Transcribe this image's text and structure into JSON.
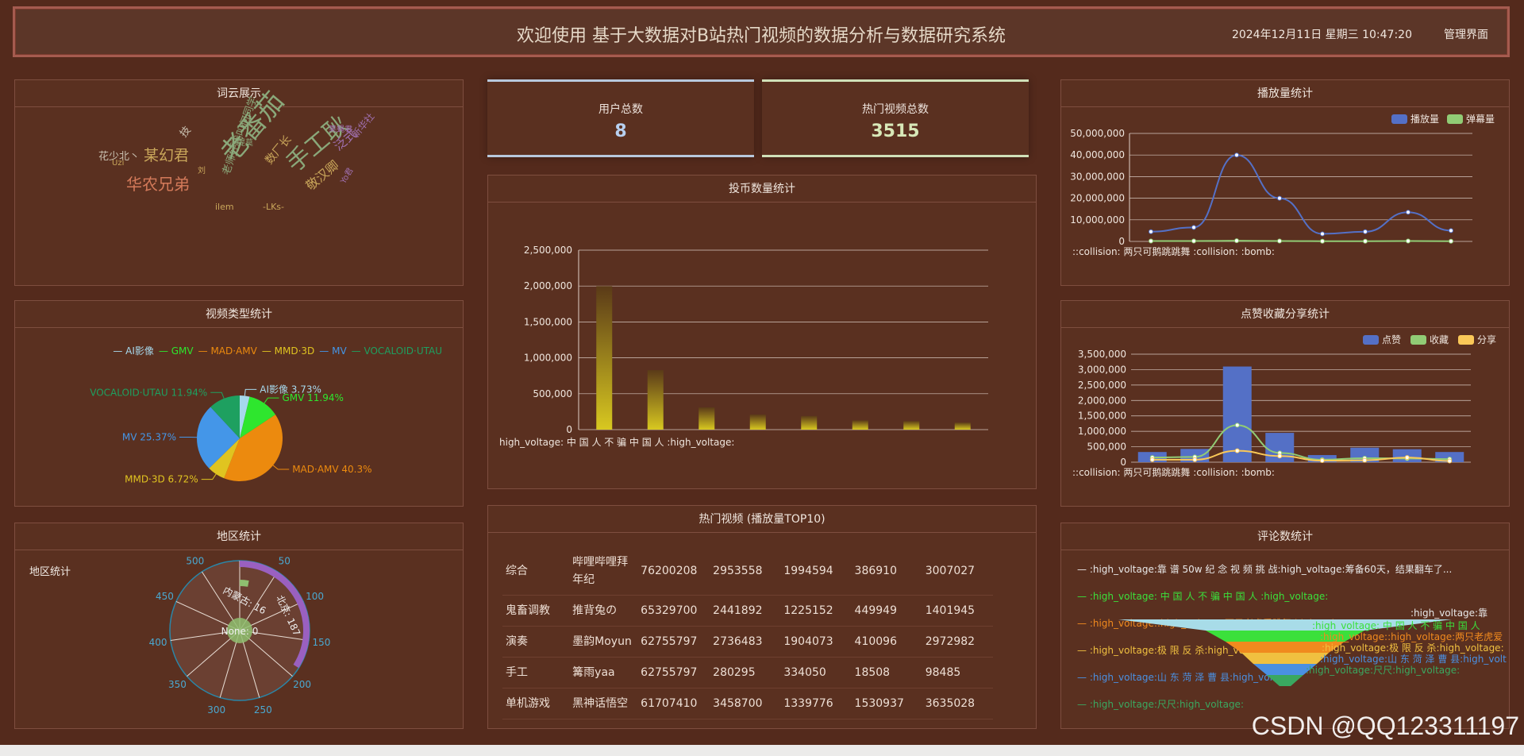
{
  "header": {
    "title": "欢迎使用 基于大数据对B站热门视频的数据分析与数据研究系统",
    "datetime": "2024年12月11日 星期三 10:47:20",
    "admin_link": "管理界面"
  },
  "panels": {
    "wordcloud": "词云展示",
    "video_type": "视频类型统计",
    "region": "地区统计",
    "coin": "投币数量统计",
    "top10": "热门视频 (播放量TOP10)",
    "play": "播放量统计",
    "like": "点赞收藏分享统计",
    "comment": "评论数统计"
  },
  "stats": {
    "users_label": "用户总数",
    "users_value": "8",
    "videos_label": "热门视频总数",
    "videos_value": "3515"
  },
  "wordcloud": [
    {
      "text": "老番茄",
      "color": "#8aa87a"
    },
    {
      "text": "手工耿",
      "color": "#8aa87a"
    },
    {
      "text": "华农兄弟",
      "color": "#d47a5a"
    },
    {
      "text": "某幻君",
      "color": "#c9a65a"
    },
    {
      "text": "花少北丶",
      "color": "#c9c0b0"
    },
    {
      "text": "敬汉卿",
      "color": "#c9a65a"
    },
    {
      "text": "老师好我叫何同学",
      "color": "#8aa87a"
    },
    {
      "text": "泛式",
      "color": "#a070b0"
    },
    {
      "text": "新华社",
      "color": "#a070b0"
    },
    {
      "text": "果蝇君",
      "color": "#a070b0"
    },
    {
      "text": "Uzi",
      "color": "#c9a65a"
    },
    {
      "text": "ilem",
      "color": "#c9a65a"
    },
    {
      "text": "-LKs-",
      "color": "#c9a65a"
    },
    {
      "text": "Yo君",
      "color": "#a070b0"
    },
    {
      "text": "技",
      "color": "#c9c0b0"
    },
    {
      "text": "数厂长",
      "color": "#c9a65a"
    },
    {
      "text": "冯提莫",
      "color": "#8aa87a"
    },
    {
      "text": "刘",
      "color": "#c9a65a"
    }
  ],
  "pie": {
    "legend": [
      "AI影像",
      "GMV",
      "MAD·AMV",
      "MMD·3D",
      "MV",
      "VOCALOID·UTAU"
    ],
    "slices": [
      {
        "name": "AI影像",
        "percent": 3.73,
        "label": "AI影像 3.73%",
        "color": "#a6d8ec"
      },
      {
        "name": "GMV",
        "percent": 11.94,
        "label": "GMV 11.94%",
        "color": "#2ee62e"
      },
      {
        "name": "MAD·AMV",
        "percent": 40.3,
        "label": "MAD·AMV 40.3%",
        "color": "#ec8a0e"
      },
      {
        "name": "MMD·3D",
        "percent": 6.72,
        "label": "MMD·3D 6.72%",
        "color": "#e0c420"
      },
      {
        "name": "MV",
        "percent": 25.37,
        "label": "MV 25.37%",
        "color": "#4496e8"
      },
      {
        "name": "VOCALOID·UTAU",
        "percent": 11.94,
        "label": "VOCALOID·UTAU 11.94%",
        "color": "#1ea060"
      }
    ]
  },
  "region": {
    "label": "地区统计",
    "ticks": [
      "0",
      "50",
      "100",
      "150",
      "200",
      "250",
      "300",
      "350",
      "400",
      "450",
      "500"
    ],
    "arc_labels": [
      "内蒙古: 16",
      "北京: 187"
    ],
    "center_label": "None: 0"
  },
  "coin_chart": {
    "type": "bar",
    "yticks": [
      "0",
      "500,000",
      "1,000,000",
      "1,500,000",
      "2,000,000",
      "2,500,000"
    ],
    "ylim": [
      0,
      2500000
    ],
    "values": [
      2000000,
      830000,
      310000,
      210000,
      190000,
      130000,
      120000,
      100000
    ],
    "xlabel_first": "high_voltage: 中 国 人 不 骗 中 国 人 :high_voltage:"
  },
  "table": {
    "rows": [
      [
        "综合",
        "哔哩哔哩拜年纪",
        "76200208",
        "2953558",
        "1994594",
        "386910",
        "3007027"
      ],
      [
        "鬼畜调教",
        "推背兔の",
        "65329700",
        "2441892",
        "1225152",
        "449949",
        "1401945"
      ],
      [
        "演奏",
        "墨韵Moyun",
        "62755797",
        "2736483",
        "1904073",
        "410096",
        "2972982"
      ],
      [
        "手工",
        "篝雨yaa",
        "62755797",
        "280295",
        "334050",
        "18508",
        "98485"
      ],
      [
        "单机游戏",
        "黑神话悟空",
        "61707410",
        "3458700",
        "1339776",
        "1530937",
        "3635028"
      ]
    ]
  },
  "play_chart": {
    "type": "line",
    "legend": [
      "播放量",
      "弹幕量"
    ],
    "yticks": [
      "0",
      "10,000,000",
      "20,000,000",
      "30,000,000",
      "40,000,000",
      "50,000,000"
    ],
    "ylim": [
      0,
      50000000
    ],
    "series": [
      {
        "name": "播放量",
        "color": "#5470c6",
        "values": [
          4500000,
          6500000,
          40000000,
          20000000,
          3500000,
          4500000,
          13500000,
          5000000
        ]
      },
      {
        "name": "弹幕量",
        "color": "#91cc75",
        "values": [
          200000,
          200000,
          300000,
          200000,
          100000,
          100000,
          200000,
          100000
        ]
      }
    ],
    "xlabel_first": "::collision: 两只可鹅跳跳舞 :collision: :bomb:"
  },
  "like_chart": {
    "type": "bar",
    "legend": [
      "点赞",
      "收藏",
      "分享"
    ],
    "yticks": [
      "0",
      "500,000",
      "1,000,000",
      "1,500,000",
      "2,000,000",
      "2,500,000",
      "3,000,000",
      "3,500,000"
    ],
    "ylim": [
      0,
      3500000
    ],
    "bars": [
      330000,
      430000,
      3100000,
      950000,
      230000,
      470000,
      420000,
      330000
    ],
    "series": [
      {
        "name": "点赞",
        "color": "#5470c6"
      },
      {
        "name": "收藏",
        "color": "#91cc75",
        "values": [
          150000,
          170000,
          1200000,
          300000,
          80000,
          130000,
          120000,
          100000
        ]
      },
      {
        "name": "分享",
        "color": "#fac858",
        "values": [
          80000,
          80000,
          370000,
          200000,
          50000,
          60000,
          150000,
          40000
        ]
      }
    ],
    "xlabel_first": "::collision: 两只可鹅跳跳舞 :collision: :bomb:"
  },
  "comments": {
    "items": [
      {
        "text": ":high_voltage:靠 谱 50w 纪 念 视 频 挑 战:high_voltage:筹备60天，结果翻车了...",
        "color": "#e8e8e8"
      },
      {
        "text": ":high_voltage: 中 国 人 不 骗 中 国 人 :high_voltage:",
        "color": "#3be03b"
      },
      {
        "text": ":high_voltage::high_voltage:两只老虎爱跳舞:high_voltage:",
        "color": "#f08a1e"
      },
      {
        "text": ":high_voltage:极 限 反 杀:high_voltage:",
        "color": "#f0c040"
      },
      {
        "text": ":high_voltage:山 东 菏 泽 曹 县:high_voltage:",
        "color": "#4a90e2"
      },
      {
        "text": ":high_voltage:尺尺:high_voltage:",
        "color": "#3aa860"
      }
    ],
    "funnel_labels": [
      {
        "text": ":high_voltage:靠",
        "color": "#e8e8e8"
      },
      {
        "text": ":high_voltage: 中 国 人 不 骗 中 国 人",
        "color": "#3be03b"
      },
      {
        "text": ":high_voltage::high_voltage:两只老虎爱",
        "color": "#f08a1e"
      },
      {
        "text": ":high_voltage:极 限 反 杀:high_voltage:",
        "color": "#f0c040"
      },
      {
        "text": ":high_voltage:山 东 菏 泽 曹 县:high_volt",
        "color": "#4a90e2"
      },
      {
        "text": ":high_voltage:尺尺:high_voltage:",
        "color": "#3aa860"
      }
    ]
  },
  "watermark": "CSDN @QQ123311197",
  "colors": {
    "bg": "#542a1c",
    "panel": "#5a3020",
    "panel_border": "#7e4e3f",
    "stat_blue": "#b8d0f0",
    "stat_green": "#d8e8b8",
    "coin_bar": "#d8c820"
  }
}
